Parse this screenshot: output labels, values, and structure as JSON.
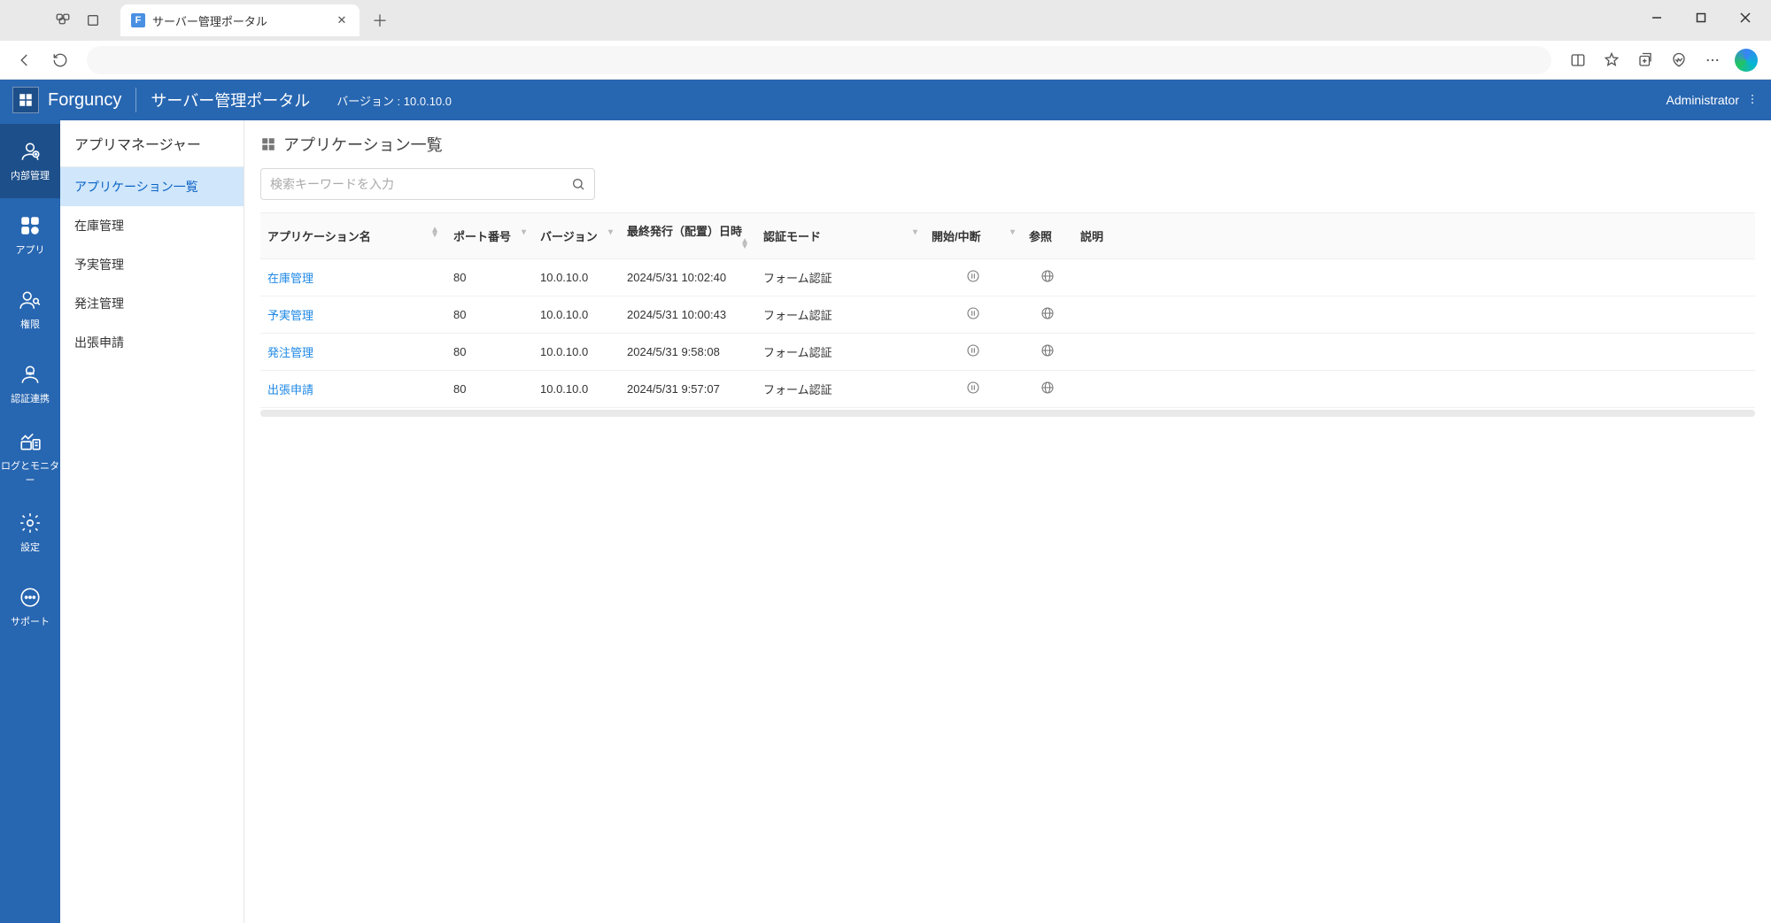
{
  "browser": {
    "tab_title": "サーバー管理ポータル",
    "favicon_letter": "F"
  },
  "header": {
    "brand": "Forguncy",
    "portal_title": "サーバー管理ポータル",
    "version_label": "バージョン : 10.0.10.0",
    "user": "Administrator"
  },
  "rail": {
    "items": [
      {
        "id": "internal",
        "label": "内部管理",
        "active": true
      },
      {
        "id": "app",
        "label": "アプリ",
        "active": false
      },
      {
        "id": "perm",
        "label": "権限",
        "active": false
      },
      {
        "id": "auth",
        "label": "認証連携",
        "active": false
      },
      {
        "id": "log",
        "label": "ログとモニター",
        "active": false
      },
      {
        "id": "settings",
        "label": "設定",
        "active": false
      },
      {
        "id": "support",
        "label": "サポート",
        "active": false
      }
    ]
  },
  "side_nav": {
    "header": "アプリマネージャー",
    "items": [
      {
        "label": "アプリケーション一覧",
        "selected": true
      },
      {
        "label": "在庫管理",
        "selected": false
      },
      {
        "label": "予実管理",
        "selected": false
      },
      {
        "label": "発注管理",
        "selected": false
      },
      {
        "label": "出張申請",
        "selected": false
      }
    ]
  },
  "main": {
    "page_title": "アプリケーション一覧",
    "search_placeholder": "検索キーワードを入力",
    "columns": {
      "name": "アプリケーション名",
      "port": "ポート番号",
      "version": "バージョン",
      "last_published": "最終発行（配置）日時",
      "auth_mode": "認証モード",
      "start_stop": "開始/中断",
      "browse": "参照",
      "description": "説明"
    },
    "rows": [
      {
        "name": "在庫管理",
        "port": "80",
        "version": "10.0.10.0",
        "last_published": "2024/5/31 10:02:40",
        "auth_mode": "フォーム認証"
      },
      {
        "name": "予実管理",
        "port": "80",
        "version": "10.0.10.0",
        "last_published": "2024/5/31 10:00:43",
        "auth_mode": "フォーム認証"
      },
      {
        "name": "発注管理",
        "port": "80",
        "version": "10.0.10.0",
        "last_published": "2024/5/31 9:58:08",
        "auth_mode": "フォーム認証"
      },
      {
        "name": "出張申請",
        "port": "80",
        "version": "10.0.10.0",
        "last_published": "2024/5/31 9:57:07",
        "auth_mode": "フォーム認証"
      }
    ]
  }
}
